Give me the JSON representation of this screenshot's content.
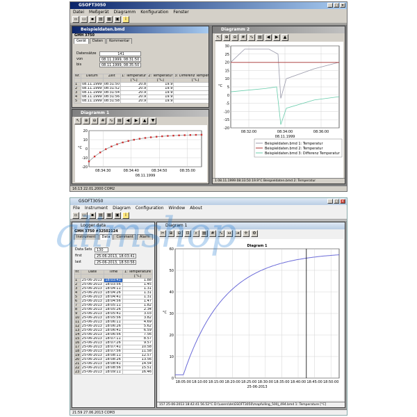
{
  "top": {
    "app_title": "GSOFT3050",
    "menu": [
      "Datei",
      "Meßgerät",
      "Diagramm",
      "Konfiguration",
      "Fenster"
    ],
    "status": "16:13  22.01.2000  COM2",
    "data_window": {
      "title": "Beispieldaten.bmd",
      "device": "GMH 3750",
      "tabs": [
        "Gerät",
        "Daten",
        "Kommentar"
      ],
      "fields": [
        {
          "label": "Datensätze",
          "value": "141"
        },
        {
          "label": "von",
          "value": "08.11.1999, 08:31:50"
        },
        {
          "label": "bis",
          "value": "08.11.1999, 08:35:50"
        }
      ],
      "columns": [
        "Nr.",
        "Datum",
        "Zeit",
        "1: Temperatur",
        "2: Temperatur",
        "3: Differenz Temperatur"
      ],
      "units": [
        "",
        "",
        "",
        "[°C]",
        "[°C]",
        "[°C]"
      ],
      "rows": [
        [
          "1",
          "08.11.1999",
          "08:31:50",
          "20.8",
          "19.9",
          "0.9"
        ],
        [
          "2",
          "08.11.1999",
          "08:31:52",
          "20.9",
          "19.9",
          "1.0"
        ],
        [
          "3",
          "08.11.1999",
          "08:31:54",
          "20.9",
          "19.9",
          "1.0"
        ],
        [
          "4",
          "08.11.1999",
          "08:31:56",
          "20.9",
          "19.9",
          "1.0"
        ],
        [
          "5",
          "08.11.1999",
          "08:31:58",
          "20.9",
          "19.9",
          "1.0"
        ]
      ]
    },
    "diagram1": {
      "title": "Diagramm 1",
      "x_ticks": [
        "08:34:30",
        "08:34:40",
        "08:34:50",
        "08:35:00"
      ],
      "x_label": "08.11.1999",
      "y_ticks": [
        "20",
        "10",
        "0",
        "-10",
        "-20"
      ],
      "y_unit": "°C"
    },
    "diagram2": {
      "title": "Diagramm 2",
      "x_ticks": [
        "08:32:00",
        "08:34:00",
        "08:36:00"
      ],
      "x_label": "08.11.1999",
      "y_ticks": [
        "30",
        "25",
        "20",
        "15",
        "10",
        "5",
        "0",
        "-5",
        "-10",
        "-15",
        "-20"
      ],
      "y_unit": "°C",
      "legend": [
        {
          "label": "Beispieldaten.bmd 1: Temperatur",
          "color": "#9999aa"
        },
        {
          "label": "Beispieldaten.bmd 2: Temperatur",
          "color": "#aa3333"
        },
        {
          "label": "Beispieldaten.bmd 3: Differenz Temperatur",
          "color": "#66ccaa"
        }
      ],
      "status": "1  08.11.1999 08:33:50  19.9°C  Beispieldaten.bmd 2: Temperatur"
    }
  },
  "bottom": {
    "app_title": "GSOFT3050",
    "menu": [
      "File",
      "Instrument",
      "Diagram",
      "Configuration",
      "Window",
      "About"
    ],
    "status": "21:59  27.06.2013  COM3",
    "data_window": {
      "title": "Logger data",
      "device": "GMH 3750 #32502124",
      "tabs": [
        "Instrument",
        "Data",
        "Comment",
        "Alarm"
      ],
      "fields": [
        {
          "label": "Data Sets",
          "value": "130"
        },
        {
          "label": "first",
          "value": "25-06-2013, 18:03:41"
        },
        {
          "label": "last",
          "value": "25-06-2013, 18:50:56"
        }
      ],
      "columns": [
        "nr.",
        "Date",
        "Time",
        "1: Temperature"
      ],
      "units": [
        "",
        "",
        "",
        "[°C]"
      ],
      "rows": [
        [
          "1",
          "25-06-2013",
          "18:03:41",
          "1.88"
        ],
        [
          "2",
          "25-06-2013",
          "18:03:56",
          "1.45"
        ],
        [
          "3",
          "25-06-2013",
          "18:04:11",
          "1.31"
        ],
        [
          "4",
          "25-06-2013",
          "18:04:26",
          "1.31"
        ],
        [
          "5",
          "25-06-2013",
          "18:04:41",
          "1.31"
        ],
        [
          "6",
          "25-06-2013",
          "18:04:56",
          "1.47"
        ],
        [
          "7",
          "25-06-2013",
          "18:05:11",
          "1.82"
        ],
        [
          "8",
          "25-06-2013",
          "18:05:26",
          "2.34"
        ],
        [
          "9",
          "25-06-2013",
          "18:05:41",
          "3.03"
        ],
        [
          "10",
          "25-06-2013",
          "18:05:56",
          "3.82"
        ],
        [
          "11",
          "25-06-2013",
          "18:06:11",
          "4.69"
        ],
        [
          "12",
          "25-06-2013",
          "18:06:26",
          "5.62"
        ],
        [
          "13",
          "25-06-2013",
          "18:06:41",
          "6.59"
        ],
        [
          "14",
          "25-06-2013",
          "18:06:56",
          "7.56"
        ],
        [
          "15",
          "25-06-2013",
          "18:07:11",
          "8.57"
        ],
        [
          "16",
          "25-06-2013",
          "18:07:26",
          "9.57"
        ],
        [
          "17",
          "25-06-2013",
          "18:07:41",
          "10.58"
        ],
        [
          "18",
          "25-06-2013",
          "18:07:56",
          "11.58"
        ],
        [
          "19",
          "25-06-2013",
          "18:08:11",
          "12.57"
        ],
        [
          "20",
          "25-06-2013",
          "18:08:26",
          "13.56"
        ],
        [
          "21",
          "25-06-2013",
          "18:08:41",
          "14.54"
        ],
        [
          "22",
          "25-06-2013",
          "18:08:56",
          "15.51"
        ],
        [
          "23",
          "25-06-2013",
          "18:09:11",
          "16.46"
        ]
      ]
    },
    "diagram": {
      "window_title": "Diagram 1",
      "title": "Diagram 1",
      "x_ticks": [
        "18:05:00",
        "18:10:00",
        "18:15:00",
        "18:20:00",
        "18:25:00",
        "18:30:00",
        "18:35:00",
        "18:40:00",
        "18:45:00",
        "18:50:00"
      ],
      "x_label": "25-06-2013",
      "y_ticks": [
        "60",
        "50",
        "40",
        "30",
        "20",
        "10",
        "0"
      ],
      "y_unit": "°C",
      "status": "157  25-06-2013  18:42:41  56.52°C  D:\\\\users\\de\\GSOFT3050\\mapfulling_500j_494.bmd  1: Temperature [°C]"
    }
  },
  "watermark": "alimshop"
}
